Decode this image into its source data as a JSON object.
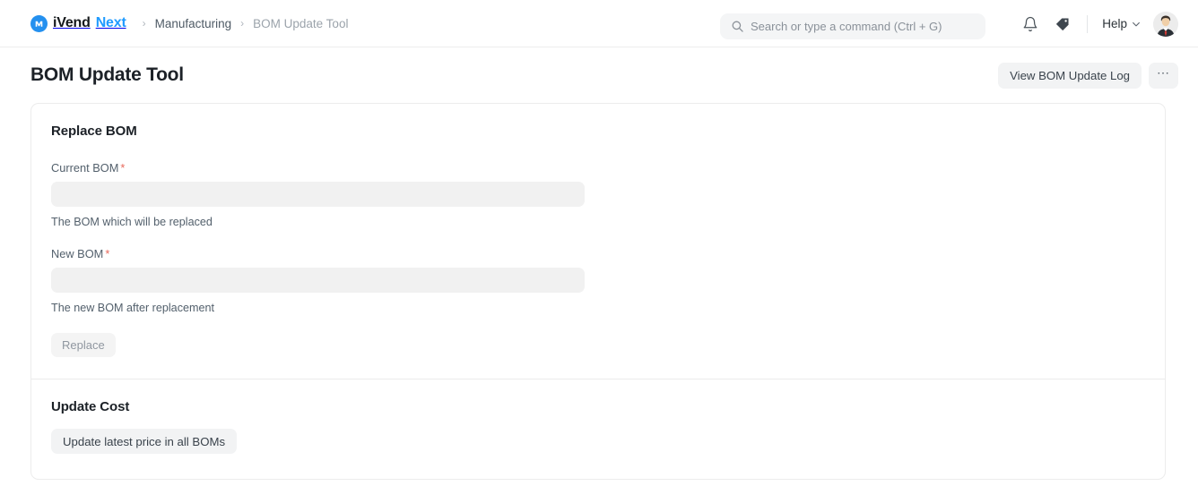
{
  "navbar": {
    "brand": {
      "part1": "iVend",
      "part2": "Next",
      "logo_icon": "ivend-logo-icon",
      "logo_color": "#2490ef"
    },
    "breadcrumbs": [
      {
        "label": "Manufacturing",
        "current": false
      },
      {
        "label": "BOM Update Tool",
        "current": true
      }
    ],
    "separator": "›",
    "search": {
      "placeholder": "Search or type a command (Ctrl + G)",
      "value": "",
      "icon": "search-icon"
    },
    "notifications_icon": "bell-icon",
    "tags_icon": "tag-icon",
    "help": {
      "label": "Help",
      "chevron": "chevron-down-icon"
    },
    "avatar_icon": "user-avatar"
  },
  "page": {
    "title": "BOM Update Tool",
    "actions": {
      "view_log_label": "View BOM Update Log",
      "more_label": "⋯"
    }
  },
  "replace_section": {
    "title": "Replace BOM",
    "current_bom": {
      "label": "Current BOM",
      "required_marker": "*",
      "value": "",
      "placeholder": "",
      "help": "The BOM which will be replaced"
    },
    "new_bom": {
      "label": "New BOM",
      "required_marker": "*",
      "value": "",
      "placeholder": "",
      "help": "The new BOM after replacement"
    },
    "replace_button": "Replace"
  },
  "update_cost_section": {
    "title": "Update Cost",
    "update_price_button": "Update latest price in all BOMs"
  },
  "colors": {
    "accent": "#2490ef",
    "brand_next": "#1f9bff",
    "required": "#e8685a",
    "field_bg": "#f1f1f1",
    "button_bg": "#f2f3f4",
    "border": "#ececec"
  }
}
